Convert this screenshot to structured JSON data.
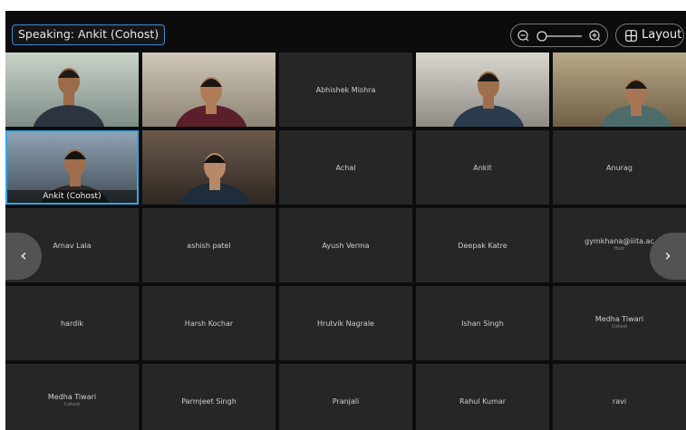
{
  "speaking_label": "Speaking: Ankit (Cohost)",
  "layout_label": "Layout",
  "participants": [
    {
      "name": "",
      "video": true
    },
    {
      "name": "",
      "video": true
    },
    {
      "name": "Abhishek Mishra"
    },
    {
      "name": "",
      "video": true
    },
    {
      "name": "",
      "video": true
    },
    {
      "name": "Ankit  (Cohost)",
      "video": true,
      "active": true
    },
    {
      "name": "",
      "video": true
    },
    {
      "name": "Achal"
    },
    {
      "name": "Ankit"
    },
    {
      "name": "Anurag"
    },
    {
      "name": "Arnav Lala"
    },
    {
      "name": "ashish patel"
    },
    {
      "name": "Ayush Verma"
    },
    {
      "name": "Deepak Katre"
    },
    {
      "name": "gymkhana@iiita.ac",
      "sub": "Host"
    },
    {
      "name": "hardik"
    },
    {
      "name": "Harsh Kochar"
    },
    {
      "name": "Hrutvik Nagrale"
    },
    {
      "name": "Ishan Singh"
    },
    {
      "name": "Medha Tiwari",
      "sub": "Cohost"
    },
    {
      "name": "Medha Tiwari",
      "sub": "Cohost"
    },
    {
      "name": "Parmjeet Singh"
    },
    {
      "name": "Pranjali"
    },
    {
      "name": "Rahul Kumar"
    },
    {
      "name": "ravi"
    }
  ],
  "colors": {
    "accent": "#2fa6e6",
    "background": "#0c0c0c",
    "tile": "#262626"
  }
}
